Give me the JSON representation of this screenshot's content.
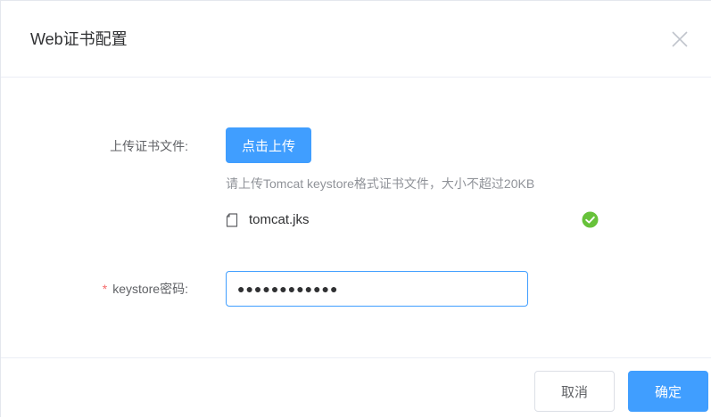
{
  "dialog": {
    "title": "Web证书配置",
    "close_icon": "close-icon"
  },
  "form": {
    "upload_label": "上传证书文件:",
    "upload_button": "点击上传",
    "upload_tip": "请上传Tomcat keystore格式证书文件，大小不超过20KB",
    "file": {
      "icon": "document-icon",
      "name": "tomcat.jks",
      "status_icon": "success-check-icon"
    },
    "password_required_mark": "*",
    "password_label": "keystore密码:",
    "password_value": "●●●●●●●●●●●●"
  },
  "footer": {
    "cancel_label": "取消",
    "confirm_label": "确定"
  },
  "colors": {
    "primary": "#409eff",
    "success": "#67c23a",
    "danger": "#f56c6c"
  }
}
